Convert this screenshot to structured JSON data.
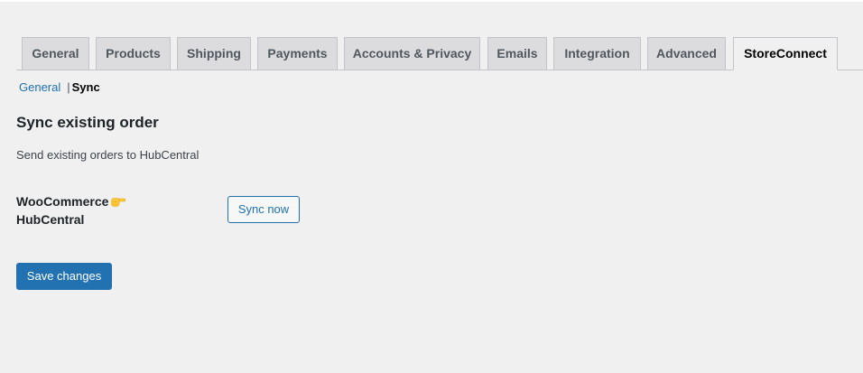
{
  "tabs": [
    {
      "label": "General",
      "active": false
    },
    {
      "label": "Products",
      "active": false
    },
    {
      "label": "Shipping",
      "active": false
    },
    {
      "label": "Payments",
      "active": false
    },
    {
      "label": "Accounts & Privacy",
      "active": false
    },
    {
      "label": "Emails",
      "active": false
    },
    {
      "label": "Integration",
      "active": false
    },
    {
      "label": "Advanced",
      "active": false
    },
    {
      "label": "StoreConnect",
      "active": true
    }
  ],
  "subnav": {
    "general_label": "General",
    "separator": "|",
    "current_label": "Sync"
  },
  "section": {
    "title": "Sync existing order",
    "description": "Send existing orders to HubCentral"
  },
  "field": {
    "label_line1": "WooCommerce",
    "label_line2": "HubCentral",
    "icon": "pointing-hand-icon",
    "button_label": "Sync now"
  },
  "footer": {
    "save_label": "Save changes"
  },
  "colors": {
    "background": "#f0f0f1",
    "accent": "#2271b1",
    "tab_inactive_bg": "#dcdcde",
    "tab_border": "#c3c4c7",
    "icon_yellow": "#ffc83d"
  }
}
